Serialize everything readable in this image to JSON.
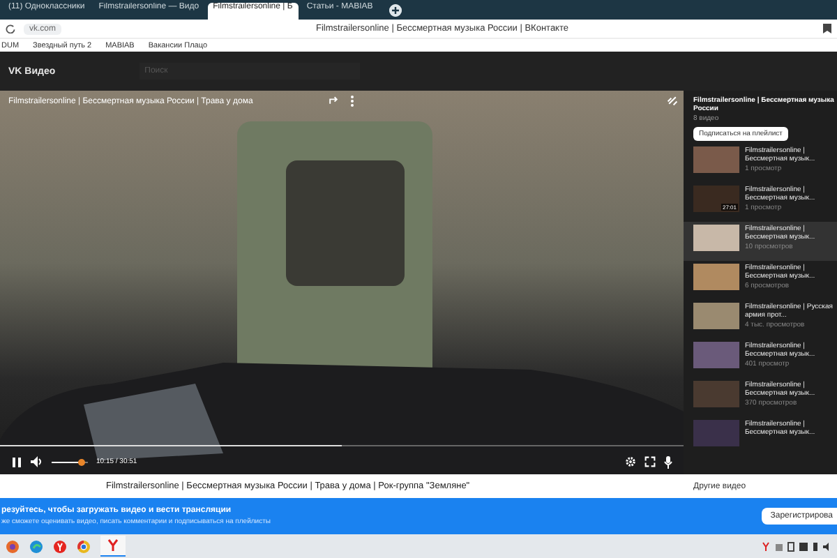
{
  "browser": {
    "tabs": [
      {
        "label": "(11) Одноклассники",
        "selected": false
      },
      {
        "label": "Filmstrailersonline — Видо",
        "selected": false
      },
      {
        "label": "Filmstrailersonline | Б",
        "selected": true
      },
      {
        "label": "Статьи - MABIAB",
        "selected": false
      }
    ],
    "address": "vk.com",
    "page_title": "Filmstrailersonline | Бессмертная музыка России | ВКонтакте",
    "bookmarks": [
      "DUM",
      "Звездный путь 2",
      "MABIAB",
      "Вакансии Плацо"
    ]
  },
  "header": {
    "title": "VK Видео",
    "search_placeholder": "Поиск"
  },
  "player": {
    "overlay_title": "Filmstrailersonline | Бессмертная музыка России | Трава у дома",
    "progress": {
      "level": 0.5
    },
    "volume": {
      "level": 0.8
    },
    "time": "10:15 / 30:51",
    "playing": true
  },
  "caption": "Filmstrailersonline | Бессмертная музыка России | Трава у дома | Рок-группа \"Земляне\"",
  "playlist": {
    "title": "Filmstrailersonline | Бессмертная музыка России",
    "count": "8 видео",
    "subscribe": "Подписаться на плейлист",
    "items": [
      {
        "title": "Filmstrailersonline | Бессмертная музык...",
        "views": "1 просмотр",
        "selected": false
      },
      {
        "title": "Filmstrailersonline | Бессмертная музык...",
        "views": "1 просмотр",
        "duration": "27:01",
        "selected": false
      },
      {
        "title": "Filmstrailersonline | Бессмертная музык...",
        "views": "10 просмотров",
        "selected": true
      },
      {
        "title": "Filmstrailersonline | Бессмертная музык...",
        "views": "6 просмотров",
        "selected": false
      },
      {
        "title": "Filmstrailersonline | Русская армия прот...",
        "views": "4 тыс. просмотров",
        "selected": false
      },
      {
        "title": "Filmstrailersonline | Бессмертная музык...",
        "views": "401 просмотр",
        "selected": false
      },
      {
        "title": "Filmstrailersonline | Бессмертная музык...",
        "views": "370 просмотров",
        "selected": false
      },
      {
        "title": "Filmstrailersonline | Бессмертная музык...",
        "selected": false
      }
    ],
    "other": "Другие видео"
  },
  "banner": {
    "title": "резуйтесь, чтобы загружать видео и вести трансляции",
    "text": "же сможете оценивать видео, писать комментарии и подписываться на плейлисты",
    "button": "Зарегистрирова"
  }
}
